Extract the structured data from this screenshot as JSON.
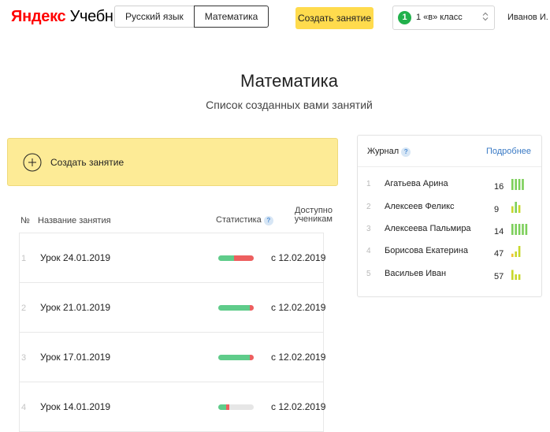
{
  "header": {
    "logo_part1": "Яндекс",
    "logo_part2": "Учебник",
    "subjects": [
      "Русский язык",
      "Математика"
    ],
    "active_subject": "Математика",
    "create_button": "Создать занятие",
    "class_select": {
      "badge": "1",
      "label": "1 «в» класс"
    },
    "user_name": "Иванов И."
  },
  "page": {
    "title": "Математика",
    "subtitle": "Список созданных вами занятий"
  },
  "create_card": {
    "label": "Создать занятие"
  },
  "table": {
    "col_num": "№",
    "col_name": "Название занятия",
    "col_stat": "Статистика",
    "col_stat_help": "?",
    "col_avail": "Доступно ученикам",
    "rows": [
      {
        "num": "1",
        "name": "Урок 24.01.2019",
        "stat_green": 0.45,
        "stat_red": 0.55,
        "date": "с  12.02.2019"
      },
      {
        "num": "2",
        "name": "Урок 21.01.2019",
        "stat_green": 0.88,
        "stat_red": 0.12,
        "date": "с  12.02.2019"
      },
      {
        "num": "3",
        "name": "Урок 17.01.2019",
        "stat_green": 0.88,
        "stat_red": 0.12,
        "date": "с  12.02.2019"
      },
      {
        "num": "4",
        "name": "Урок 14.01.2019",
        "stat_green": 0.22,
        "stat_red": 0.1,
        "date": "с  12.02.2019"
      }
    ]
  },
  "journal": {
    "title": "Журнал",
    "help": "?",
    "more": "Подробнее",
    "students": [
      {
        "num": "1",
        "name": "Агатьева Арина",
        "count": "16",
        "levels": [
          1,
          1,
          1,
          1,
          0
        ],
        "colors": [
          "#7ccf5a",
          "#7ccf5a",
          "#7ccf5a",
          "#7ccf5a"
        ]
      },
      {
        "num": "2",
        "name": "Алексеев Феликс",
        "count": "9",
        "levels": [
          0.6,
          1,
          0.7,
          0
        ],
        "colors": [
          "#c7d82a",
          "#7ccf5a",
          "#c7d82a"
        ]
      },
      {
        "num": "3",
        "name": "Алексеева Пальмира",
        "count": "14",
        "levels": [
          1,
          1,
          1,
          1,
          1
        ],
        "colors": [
          "#7ccf5a",
          "#7ccf5a",
          "#7ccf5a",
          "#7ccf5a",
          "#7ccf5a"
        ]
      },
      {
        "num": "4",
        "name": "Борисова Екатерина",
        "count": "47",
        "levels": [
          0.3,
          0.5,
          1
        ],
        "colors": [
          "#f2c230",
          "#c7d82a",
          "#c7d82a"
        ]
      },
      {
        "num": "5",
        "name": "Васильев Иван",
        "count": "57",
        "levels": [
          0.9,
          0.5,
          0.5
        ],
        "colors": [
          "#c7d82a",
          "#c7d82a",
          "#c7d82a"
        ]
      }
    ]
  },
  "colors": {
    "accent": "#ffdb4d",
    "card": "#fdeb96",
    "link": "#3a7ac5",
    "green": "#5fcc8a",
    "red": "#ed5f5f"
  }
}
